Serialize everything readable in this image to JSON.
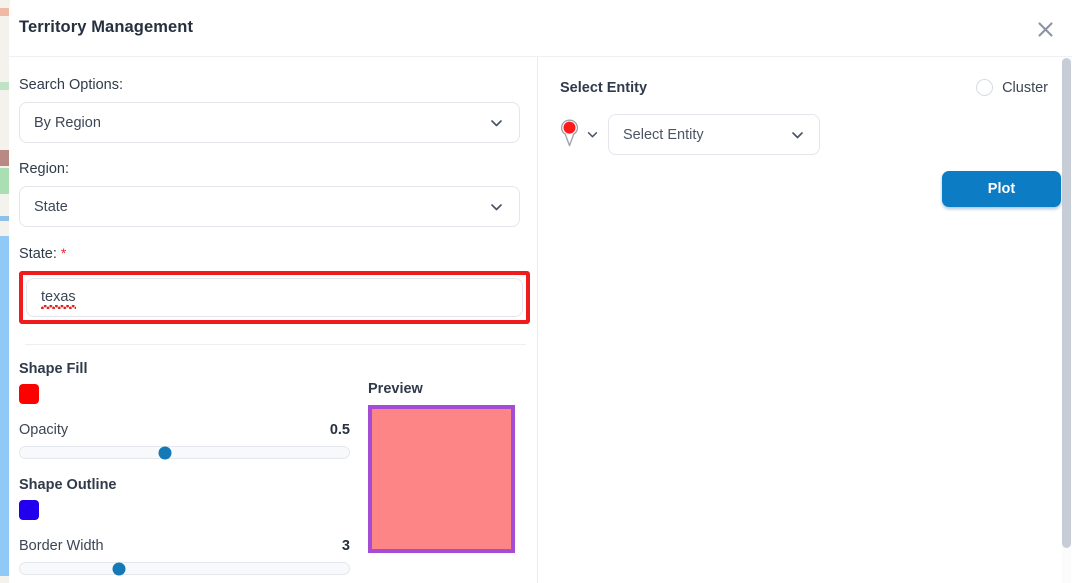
{
  "modal": {
    "title": "Territory Management",
    "close_icon": "close-icon"
  },
  "left_panel": {
    "search_options": {
      "label": "Search Options:",
      "value": "By Region",
      "chevron_icon": "chevron-down-icon"
    },
    "region": {
      "label": "Region:",
      "value": "State",
      "chevron_icon": "chevron-down-icon"
    },
    "state": {
      "label": "State:",
      "required_marker": "*",
      "value": "texas",
      "placeholder": "",
      "invalid": true
    },
    "shape_fill": {
      "label": "Shape Fill",
      "color": "#FF0000"
    },
    "opacity": {
      "label": "Opacity",
      "value": "0.5",
      "percent": 44
    },
    "shape_outline": {
      "label": "Shape Outline",
      "color": "#2200EE"
    },
    "border_width": {
      "label": "Border Width",
      "value": "3",
      "percent": 30
    },
    "preview": {
      "label": "Preview",
      "fill_color": "#FD8585",
      "border_color": "#A54CD4"
    }
  },
  "right_panel": {
    "title": "Select Entity",
    "cluster": {
      "label": "Cluster",
      "checked": false
    },
    "marker": {
      "pin_icon": "map-pin-icon",
      "pin_color": "#FF1A1A",
      "chevron_icon": "chevron-down-icon"
    },
    "entity_select": {
      "value": "Select Entity",
      "chevron_icon": "chevron-down-icon"
    },
    "plot_button": {
      "label": "Plot",
      "color": "#0C7CC4"
    }
  }
}
